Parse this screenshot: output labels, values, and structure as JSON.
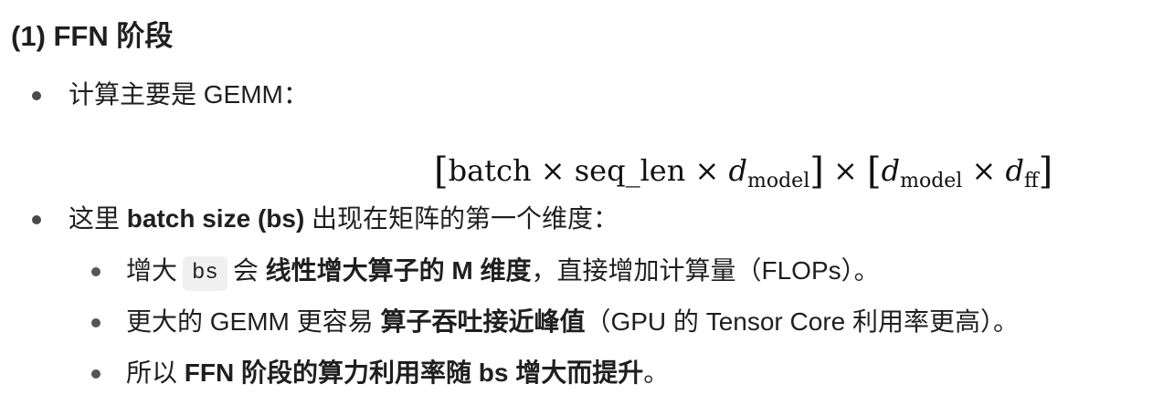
{
  "heading": "(1) FFN 阶段",
  "bullet1": {
    "text": "计算主要是 GEMM："
  },
  "formula": {
    "lbracket1": "[",
    "batch": "batch",
    "times1": " × ",
    "seq_len": "seq_len",
    "times2": " × ",
    "d1": "d",
    "d1_sub": "model",
    "rbracket1": "]",
    "times3": " × ",
    "lbracket2": "[",
    "d2": "d",
    "d2_sub": "model",
    "times4": " × ",
    "d3": "d",
    "d3_sub": "ff",
    "rbracket2": "]"
  },
  "bullet2": {
    "pre": "这里 ",
    "bold": "batch size (bs)",
    "post": " 出现在矩阵的第一个维度："
  },
  "sub1": {
    "pre": "增大",
    "code": "bs",
    "mid": "会 ",
    "bold": "线性增大算子的 M 维度",
    "post": "，直接增加计算量（FLOPs）。"
  },
  "sub2": {
    "pre": "更大的 GEMM 更容易 ",
    "bold": "算子吞吐接近峰值",
    "post": "（GPU 的 Tensor Core 利用率更高）。"
  },
  "sub3": {
    "pre": "所以 ",
    "bold": "FFN 阶段的算力利用率随 bs 增大而提升",
    "post": "。"
  }
}
